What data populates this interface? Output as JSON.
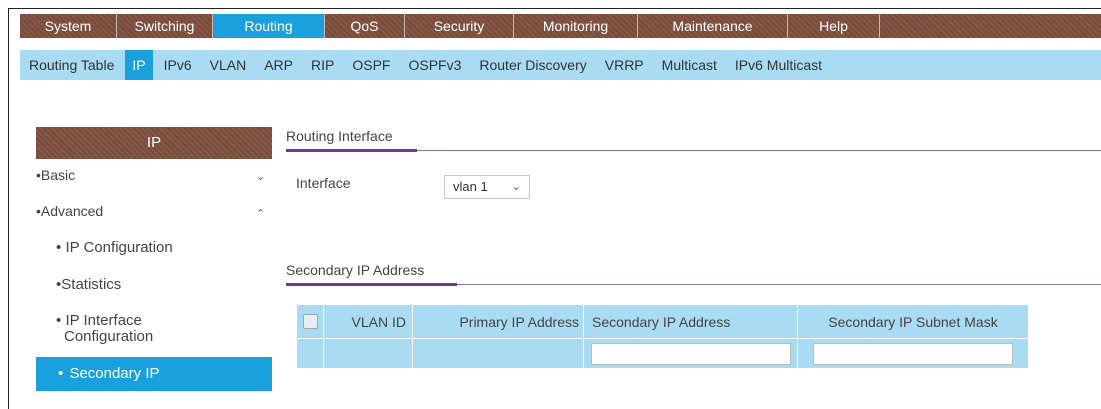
{
  "topnav": {
    "tabs": [
      {
        "label": "System",
        "width": 97
      },
      {
        "label": "Switching",
        "width": 96
      },
      {
        "label": "Routing",
        "width": 112,
        "active": true
      },
      {
        "label": "QoS",
        "width": 80
      },
      {
        "label": "Security",
        "width": 109
      },
      {
        "label": "Monitoring",
        "width": 124
      },
      {
        "label": "Maintenance",
        "width": 150
      },
      {
        "label": "Help",
        "width": 92
      },
      {
        "label": "",
        "width": 221
      }
    ]
  },
  "subnav": {
    "items": [
      "Routing Table",
      "IP",
      "IPv6",
      "VLAN",
      "ARP",
      "RIP",
      "OSPF",
      "OSPFv3",
      "Router Discovery",
      "VRRP",
      "Multicast",
      "IPv6 Multicast"
    ],
    "active_index": 1
  },
  "sidebar": {
    "header": "IP",
    "basic": "Basic",
    "advanced": "Advanced",
    "ip_configuration": "IP Configuration",
    "statistics": "Statistics",
    "ip_interface_configuration_line1": "IP Interface",
    "ip_interface_configuration_line2": "Configuration",
    "secondary_ip": "Secondary IP",
    "bullet": "•"
  },
  "routing_interface": {
    "title": "Routing Interface",
    "interface_label": "Interface",
    "interface_value": "vlan 1"
  },
  "secondary_ip": {
    "title": "Secondary IP Address",
    "columns": [
      "VLAN ID",
      "Primary IP Address",
      "Secondary IP Address",
      "Secondary IP Subnet Mask"
    ]
  },
  "colors": {
    "accent": "#1aa0dc",
    "brand": "#7a4a3a",
    "subnav": "#a9dcf2",
    "section_line": "#6b3d91"
  }
}
